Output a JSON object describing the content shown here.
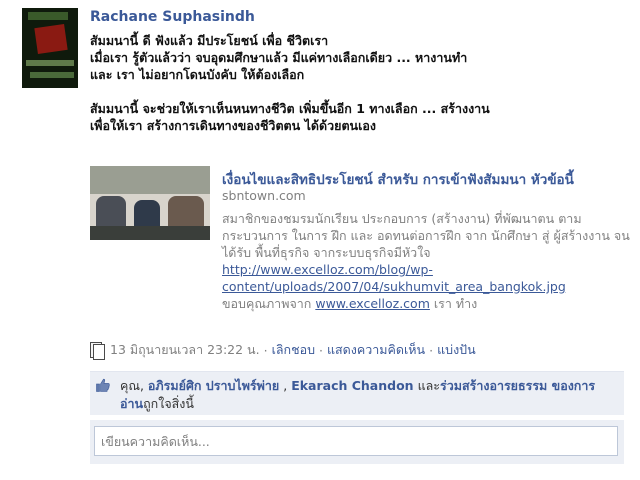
{
  "post": {
    "author": "Rachane Suphasindh",
    "message": "สัมมนานี้ ดี ฟังแล้ว มีประโยชน์ เพื่อ ชีวิตเรา\nเมื่อเรา รู้ตัวแล้วว่า จบอุดมศึกษาแล้ว มีแค่ทางเลือกเดียว ... หางานทำ\nและ เรา ไม่อยากโดนบังคับ ให้ต้องเลือก\n\nสัมมนานี้ จะช่วยให้เราเห็นหนทางชีวิต เพิ่มขึ้นอีก 1 ทางเลือก ... สร้างงาน\nเพื่อให้เรา สร้างการเดินทางของชีวิตตน ได้ด้วยตนเอง"
  },
  "shared_link": {
    "title": "เงื่อนไขและสิทธิประโยชน์ สำหรับ การเข้าฟังสัมมนา หัวข้อนี้",
    "domain": "sbntown.com",
    "description": "สมาชิกของชมรมนักเรียน ประกอบการ (สร้างงาน) ที่พัฒนาตน ตามกระบวนการ ในการ ฝึก และ อดทนต่อการฝึก จาก นักศึกษา สู่ ผู้สร้างงาน จนได้รับ พื้นที่ธุรกิจ จากระบบธุรกิจมีหัวใจ",
    "url": "http://www.excelloz.com/blog/wp-content/uploads/2007/04/sukhumvit_area_bangkok.jpg",
    "credit_prefix": "ขอบคุณภาพจาก",
    "credit_site": "www.excelloz.com",
    "credit_suffix": "เรา ทำง"
  },
  "meta": {
    "timestamp": "13 มิถุนายนเวลา 23:22 น.",
    "separator": "·",
    "unlike": "เลิกชอบ",
    "comment": "แสดงความคิดเห็น",
    "share": "แบ่งปัน"
  },
  "likes": {
    "prefix": "คุณ,",
    "name1": "อภิรมย์ศิก ปราบไพร์พ่าย",
    "sep": ",",
    "name2": "Ekarach Chandon",
    "mid": "และ",
    "group": "ร่วมสร้างอารยธรรม ของการอ่าน",
    "suffix": "ถูกใจสิ่งนี้"
  },
  "comment_box": {
    "placeholder": "เขียนความคิดเห็น..."
  },
  "colors": {
    "link_blue": "#3b5998",
    "meta_gray": "#808080",
    "panel_bg": "#eceff5"
  },
  "icons": [
    "comment-page-icon",
    "like-thumb-icon"
  ]
}
